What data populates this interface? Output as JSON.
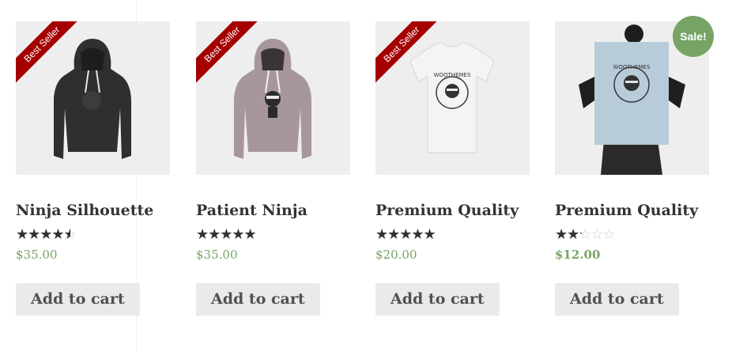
{
  "products": [
    {
      "title": "Ninja Silhouette",
      "price": "$35.00",
      "rating": 4.0,
      "badge": "Best Seller",
      "button": "Add to cart"
    },
    {
      "title": "Patient Ninja",
      "price": "$35.00",
      "rating": 5.0,
      "badge": "Best Seller",
      "button": "Add to cart"
    },
    {
      "title": "Premium Quality",
      "price": "$20.00",
      "rating": 4.5,
      "badge": "Best Seller",
      "button": "Add to cart"
    },
    {
      "title": "Premium Quality",
      "price": "$12.00",
      "rating": 2.0,
      "sale": "Sale!",
      "button": "Add to cart"
    }
  ],
  "poster": {
    "line1": "WOOTHEMES"
  },
  "shirt": {
    "line1": "WOOTHEMES"
  },
  "colors": {
    "price": "#77a464",
    "ribbon": "#a40000",
    "sale": "#77a464",
    "button_bg": "#ebe9eb"
  }
}
